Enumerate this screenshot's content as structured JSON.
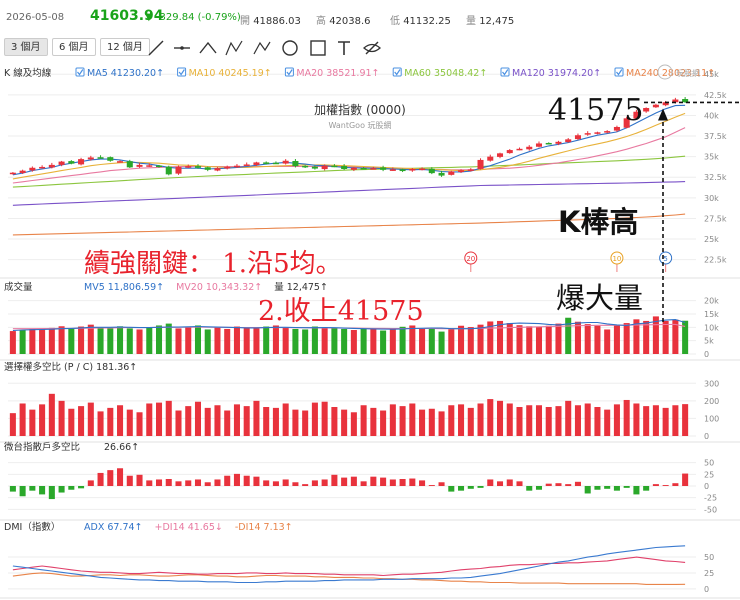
{
  "quote": {
    "date": "2026-05-08",
    "price": "41603.94",
    "change": "-329.84 (-0.79%)",
    "open_label": "開",
    "open": "41886.03",
    "high_label": "高",
    "high": "42038.6",
    "low_label": "低",
    "low": "41132.25",
    "vol_label": "量",
    "vol": "12,475"
  },
  "toolbar": {
    "periods": [
      "3 個月",
      "6 個月",
      "12 個月"
    ],
    "active_period": "3 個月",
    "tools": [
      "line-tool-icon",
      "horizontal-line-tool-icon",
      "polyline-tool-icon",
      "abcd-pattern-tool-icon",
      "abc-pattern-tool-icon",
      "circle-tool-icon",
      "rectangle-tool-icon",
      "text-tool-icon",
      "hide-drawings-icon"
    ]
  },
  "colors": {
    "up": "#e8323c",
    "down": "#2aa82a",
    "ma5": "#2f72c8",
    "ma10": "#e8b23a",
    "ma20": "#e879a0",
    "ma60": "#8cc63f",
    "ma120": "#7a52c8",
    "ma240": "#e8844a"
  },
  "chart_data": [
    {
      "type": "candlestick",
      "title": "加權指數 (0000)",
      "subtitle": "WantGoo 玩股網",
      "legend_title": "K 線及均線",
      "legend": [
        {
          "name": "MA5",
          "value": "41230.20↑"
        },
        {
          "name": "MA10",
          "value": "40245.19↑"
        },
        {
          "name": "MA20",
          "value": "38521.91↑"
        },
        {
          "name": "MA60",
          "value": "35048.42↑"
        },
        {
          "name": "MA120",
          "value": "31974.20↑"
        },
        {
          "name": "MA240",
          "value": "28023.11↑"
        }
      ],
      "yticks": [
        "45k",
        "42.5k",
        "40k",
        "37.5k",
        "35k",
        "32.5k",
        "30k",
        "27.5k",
        "25k",
        "22.5k"
      ],
      "ylim": [
        21000,
        46000
      ],
      "close": [
        33050,
        33300,
        33650,
        33750,
        34000,
        34400,
        34150,
        34700,
        34900,
        34850,
        34500,
        34450,
        33700,
        34000,
        33950,
        33750,
        32850,
        33750,
        33850,
        33650,
        33400,
        33600,
        33750,
        33900,
        34050,
        34300,
        34200,
        34250,
        34500,
        33850,
        33700,
        33550,
        33900,
        33800,
        33500,
        33650,
        33550,
        33600,
        33400,
        33450,
        33250,
        33500,
        33550,
        33000,
        32700,
        33200,
        33350,
        33450,
        34600,
        35000,
        35400,
        35800,
        35950,
        36200,
        36600,
        36650,
        36800,
        37100,
        37600,
        37850,
        37950,
        38100,
        38600,
        39650,
        40450,
        40900,
        41300,
        41600,
        41934,
        41604
      ],
      "ma5": [
        32800,
        33000,
        33300,
        33500,
        33700,
        34000,
        34200,
        34400,
        34600,
        34700,
        34700,
        34600,
        34400,
        34200,
        34100,
        33900,
        33700,
        33600,
        33600,
        33600,
        33500,
        33550,
        33600,
        33700,
        33800,
        33950,
        34100,
        34200,
        34300,
        34200,
        34100,
        33950,
        33900,
        33800,
        33700,
        33650,
        33600,
        33600,
        33550,
        33500,
        33450,
        33400,
        33450,
        33350,
        33200,
        33150,
        33150,
        33250,
        33600,
        33900,
        34300,
        34700,
        35200,
        35600,
        36000,
        36300,
        36500,
        36700,
        37000,
        37300,
        37600,
        37800,
        38000,
        38500,
        39100,
        39700,
        40300,
        40800,
        41200,
        41230
      ],
      "ma10": [
        32300,
        32500,
        32700,
        32900,
        33100,
        33300,
        33500,
        33700,
        33900,
        34050,
        34150,
        34250,
        34300,
        34300,
        34250,
        34200,
        34100,
        34000,
        33950,
        33900,
        33800,
        33750,
        33700,
        33700,
        33700,
        33750,
        33800,
        33850,
        33900,
        33950,
        34000,
        34000,
        34000,
        33950,
        33900,
        33850,
        33800,
        33750,
        33700,
        33650,
        33600,
        33550,
        33500,
        33450,
        33400,
        33350,
        33300,
        33300,
        33400,
        33550,
        33700,
        33900,
        34150,
        34450,
        34800,
        35100,
        35400,
        35700,
        36000,
        36300,
        36550,
        36800,
        37100,
        37450,
        37850,
        38300,
        38800,
        39300,
        39800,
        40245
      ],
      "ma20": [
        31800,
        31950,
        32100,
        32250,
        32400,
        32550,
        32700,
        32850,
        33000,
        33150,
        33300,
        33400,
        33500,
        33600,
        33650,
        33700,
        33750,
        33800,
        33800,
        33800,
        33800,
        33800,
        33800,
        33800,
        33800,
        33800,
        33800,
        33800,
        33800,
        33800,
        33800,
        33800,
        33800,
        33800,
        33800,
        33750,
        33700,
        33650,
        33600,
        33600,
        33550,
        33500,
        33500,
        33450,
        33450,
        33400,
        33400,
        33400,
        33450,
        33500,
        33550,
        33600,
        33700,
        33800,
        33950,
        34100,
        34250,
        34450,
        34650,
        34850,
        35100,
        35350,
        35600,
        35900,
        36250,
        36600,
        37000,
        37400,
        37950,
        38522
      ],
      "ma60": [
        31300,
        31370,
        31440,
        31510,
        31580,
        31650,
        31720,
        31790,
        31860,
        31930,
        32000,
        32070,
        32140,
        32210,
        32280,
        32350,
        32410,
        32470,
        32530,
        32590,
        32650,
        32700,
        32750,
        32800,
        32850,
        32900,
        32950,
        33000,
        33050,
        33100,
        33150,
        33200,
        33250,
        33300,
        33350,
        33400,
        33430,
        33460,
        33490,
        33520,
        33550,
        33580,
        33610,
        33640,
        33670,
        33700,
        33730,
        33760,
        33800,
        33850,
        33900,
        33950,
        34000,
        34050,
        34100,
        34150,
        34200,
        34250,
        34300,
        34350,
        34400,
        34450,
        34500,
        34560,
        34620,
        34680,
        34750,
        34830,
        34940,
        35048
      ],
      "ma120": [
        29100,
        29150,
        29200,
        29250,
        29300,
        29350,
        29400,
        29450,
        29500,
        29550,
        29600,
        29650,
        29700,
        29750,
        29800,
        29850,
        29900,
        29950,
        30000,
        30050,
        30100,
        30150,
        30200,
        30250,
        30300,
        30350,
        30400,
        30450,
        30500,
        30550,
        30600,
        30650,
        30700,
        30750,
        30800,
        30850,
        30900,
        30950,
        31000,
        31050,
        31100,
        31150,
        31200,
        31250,
        31300,
        31350,
        31400,
        31450,
        31500,
        31520,
        31540,
        31560,
        31580,
        31600,
        31620,
        31640,
        31660,
        31680,
        31700,
        31720,
        31740,
        31760,
        31780,
        31800,
        31820,
        31850,
        31880,
        31910,
        31940,
        31974
      ],
      "ma240": [
        25500,
        25530,
        25560,
        25590,
        25620,
        25650,
        25680,
        25710,
        25740,
        25770,
        25800,
        25830,
        25860,
        25890,
        25920,
        25950,
        25980,
        26010,
        26040,
        26070,
        26100,
        26130,
        26160,
        26190,
        26220,
        26250,
        26280,
        26310,
        26340,
        26370,
        26400,
        26430,
        26460,
        26490,
        26520,
        26550,
        26580,
        26610,
        26640,
        26670,
        26700,
        26730,
        26760,
        26790,
        26820,
        26850,
        26880,
        26910,
        26940,
        26980,
        27020,
        27060,
        27100,
        27140,
        27180,
        27220,
        27260,
        27300,
        27340,
        27380,
        27420,
        27460,
        27500,
        27560,
        27620,
        27680,
        27750,
        27830,
        27920,
        28023
      ],
      "event_markers": [
        {
          "label": "20",
          "index": 47
        },
        {
          "label": "10",
          "index": 62
        },
        {
          "label": "5",
          "index": 67
        }
      ],
      "annotations": [
        "41575",
        "K棒高",
        "續強關鍵： 1.沿5均。",
        "2.收上41575",
        "爆大量"
      ],
      "reference_level": 41575
    },
    {
      "type": "bar",
      "title": "成交量",
      "legend": [
        {
          "name": "MV5",
          "value": "11,806.59↑"
        },
        {
          "name": "MV20",
          "value": "10,343.32↑"
        },
        {
          "name": "量",
          "value": "12,475↑"
        }
      ],
      "yticks": [
        "20k",
        "15k",
        "10k",
        "5k",
        "0"
      ],
      "ylim": [
        0,
        21000
      ],
      "values": [
        8600,
        9000,
        9400,
        9200,
        9800,
        10400,
        9600,
        10300,
        11000,
        10000,
        9600,
        10400,
        9600,
        9200,
        10000,
        10700,
        11400,
        9600,
        10200,
        10700,
        9200,
        10000,
        9400,
        10300,
        9800,
        9600,
        10300,
        10700,
        9800,
        9400,
        9200,
        10300,
        10000,
        9600,
        9400,
        9000,
        9600,
        9400,
        8800,
        9200,
        10200,
        10700,
        9400,
        9600,
        8400,
        9300,
        10600,
        10100,
        11000,
        12200,
        12400,
        11600,
        10800,
        10400,
        10200,
        10600,
        11400,
        13600,
        12100,
        11200,
        10600,
        9200,
        10800,
        11600,
        13000,
        12400,
        14100,
        12400,
        12900,
        12475
      ],
      "mv5": [
        8800,
        9000,
        9100,
        9200,
        9300,
        9500,
        9600,
        9800,
        10000,
        10000,
        10000,
        10100,
        10000,
        9900,
        9900,
        10000,
        10100,
        10100,
        10200,
        10300,
        10200,
        10100,
        10000,
        9900,
        9800,
        9800,
        9900,
        10000,
        10000,
        9950,
        9850,
        9850,
        9900,
        9850,
        9700,
        9600,
        9500,
        9400,
        9350,
        9300,
        9400,
        9550,
        9650,
        9750,
        9700,
        9500,
        9500,
        9500,
        9700,
        10300,
        11000,
        11400,
        11600,
        11500,
        11400,
        11100,
        10900,
        11300,
        11600,
        11800,
        11800,
        11300,
        10900,
        10700,
        11300,
        11600,
        12200,
        12700,
        12900,
        11807
      ],
      "mv20": [
        9500,
        9500,
        9500,
        9550,
        9550,
        9600,
        9600,
        9650,
        9700,
        9750,
        9800,
        9850,
        9900,
        9900,
        9950,
        10000,
        10000,
        10050,
        10050,
        10100,
        10050,
        10000,
        10000,
        9950,
        9950,
        9900,
        9900,
        9900,
        9900,
        9850,
        9850,
        9800,
        9800,
        9750,
        9700,
        9700,
        9650,
        9600,
        9600,
        9550,
        9550,
        9550,
        9550,
        9550,
        9500,
        9500,
        9500,
        9550,
        9600,
        9700,
        9800,
        9900,
        10000,
        10100,
        10200,
        10300,
        10400,
        10500,
        10600,
        10700,
        10750,
        10750,
        10800,
        10850,
        10900,
        10950,
        11000,
        11050,
        11100,
        10343
      ],
      "up_flags": [
        1,
        0,
        1,
        1,
        1,
        1,
        0,
        1,
        1,
        0,
        0,
        0,
        0,
        1,
        0,
        0,
        0,
        1,
        1,
        0,
        0,
        1,
        1,
        1,
        1,
        1,
        0,
        1,
        1,
        0,
        0,
        0,
        1,
        0,
        0,
        1,
        0,
        1,
        0,
        1,
        0,
        1,
        1,
        0,
        0,
        1,
        1,
        1,
        1,
        1,
        1,
        1,
        1,
        1,
        1,
        1,
        1,
        0,
        1,
        1,
        1,
        1,
        1,
        1,
        1,
        1,
        1,
        1,
        1,
        0
      ]
    },
    {
      "type": "bar",
      "title": "選擇權多空比 (P / C)",
      "legend_value": "181.36↑",
      "yticks": [
        "300",
        "200",
        "100",
        "0"
      ],
      "ylim": [
        0,
        330
      ],
      "values": [
        130,
        185,
        150,
        180,
        240,
        200,
        155,
        170,
        190,
        140,
        160,
        175,
        150,
        135,
        185,
        190,
        200,
        145,
        170,
        195,
        160,
        175,
        145,
        180,
        170,
        200,
        165,
        160,
        185,
        150,
        145,
        190,
        195,
        165,
        150,
        135,
        175,
        160,
        145,
        180,
        170,
        185,
        150,
        155,
        140,
        175,
        180,
        160,
        185,
        210,
        200,
        185,
        165,
        175,
        175,
        165,
        170,
        200,
        175,
        185,
        165,
        150,
        180,
        205,
        185,
        170,
        175,
        160,
        175,
        181.36
      ]
    },
    {
      "type": "bar",
      "title": "微台指散戶多空比",
      "legend_value": "26.66↑",
      "yticks": [
        "50",
        "25",
        "0",
        "-25",
        "-50"
      ],
      "ylim": [
        -60,
        60
      ],
      "values": [
        -12,
        -22,
        -10,
        -18,
        -28,
        -14,
        -8,
        -5,
        12,
        28,
        34,
        38,
        22,
        24,
        12,
        14,
        15,
        10,
        12,
        14,
        8,
        14,
        22,
        26,
        22,
        20,
        12,
        10,
        14,
        8,
        4,
        12,
        14,
        24,
        18,
        20,
        10,
        20,
        18,
        14,
        15,
        16,
        12,
        2,
        8,
        -12,
        -10,
        -6,
        -4,
        14,
        10,
        14,
        10,
        -10,
        -8,
        5,
        6,
        4,
        9,
        -16,
        -8,
        -6,
        -10,
        -4,
        -18,
        -10,
        4,
        2,
        6,
        26.66
      ]
    },
    {
      "type": "line",
      "title": "DMI（指數）",
      "legend": [
        {
          "name": "ADX",
          "value": "67.74↑"
        },
        {
          "name": "+DI14",
          "value": "41.65↓"
        },
        {
          "name": "-DI14",
          "value": "7.13↑"
        }
      ],
      "yticks": [
        "50",
        "25",
        "0"
      ],
      "ylim": [
        -5,
        80
      ],
      "adx": [
        36,
        34,
        32,
        30,
        28,
        26,
        24,
        22,
        20,
        18,
        17,
        16,
        15,
        14,
        14,
        13,
        13,
        12,
        12,
        12,
        11,
        11,
        11,
        10,
        10,
        10,
        11,
        11,
        12,
        12,
        12,
        12,
        13,
        13,
        14,
        14,
        14,
        14,
        15,
        15,
        15,
        16,
        16,
        16,
        16,
        17,
        17,
        18,
        20,
        22,
        24,
        27,
        30,
        33,
        36,
        39,
        42,
        44,
        47,
        50,
        52,
        55,
        57,
        59,
        61,
        63,
        65,
        66,
        67,
        67.74
      ],
      "pdi": [
        30,
        32,
        34,
        36,
        34,
        32,
        30,
        28,
        27,
        26,
        26,
        25,
        24,
        24,
        25,
        26,
        25,
        24,
        24,
        23,
        23,
        24,
        24,
        24,
        25,
        25,
        24,
        24,
        25,
        24,
        24,
        24,
        23,
        23,
        22,
        22,
        22,
        22,
        21,
        22,
        23,
        23,
        24,
        25,
        26,
        28,
        30,
        31,
        32,
        34,
        35,
        37,
        38,
        38,
        39,
        40,
        40,
        41,
        41,
        42,
        43,
        44,
        46,
        48,
        50,
        48,
        46,
        44,
        43,
        41.65
      ],
      "mdi": [
        20,
        22,
        24,
        25,
        24,
        22,
        20,
        20,
        21,
        22,
        22,
        21,
        22,
        22,
        21,
        20,
        20,
        21,
        22,
        22,
        21,
        20,
        20,
        19,
        19,
        20,
        21,
        21,
        20,
        20,
        20,
        19,
        19,
        18,
        18,
        18,
        17,
        17,
        16,
        16,
        15,
        15,
        14,
        14,
        13,
        12,
        12,
        11,
        11,
        10,
        10,
        10,
        9,
        9,
        9,
        9,
        9,
        8,
        8,
        8,
        8,
        8,
        8,
        8,
        8,
        7,
        7,
        7,
        7,
        7.13
      ]
    }
  ]
}
